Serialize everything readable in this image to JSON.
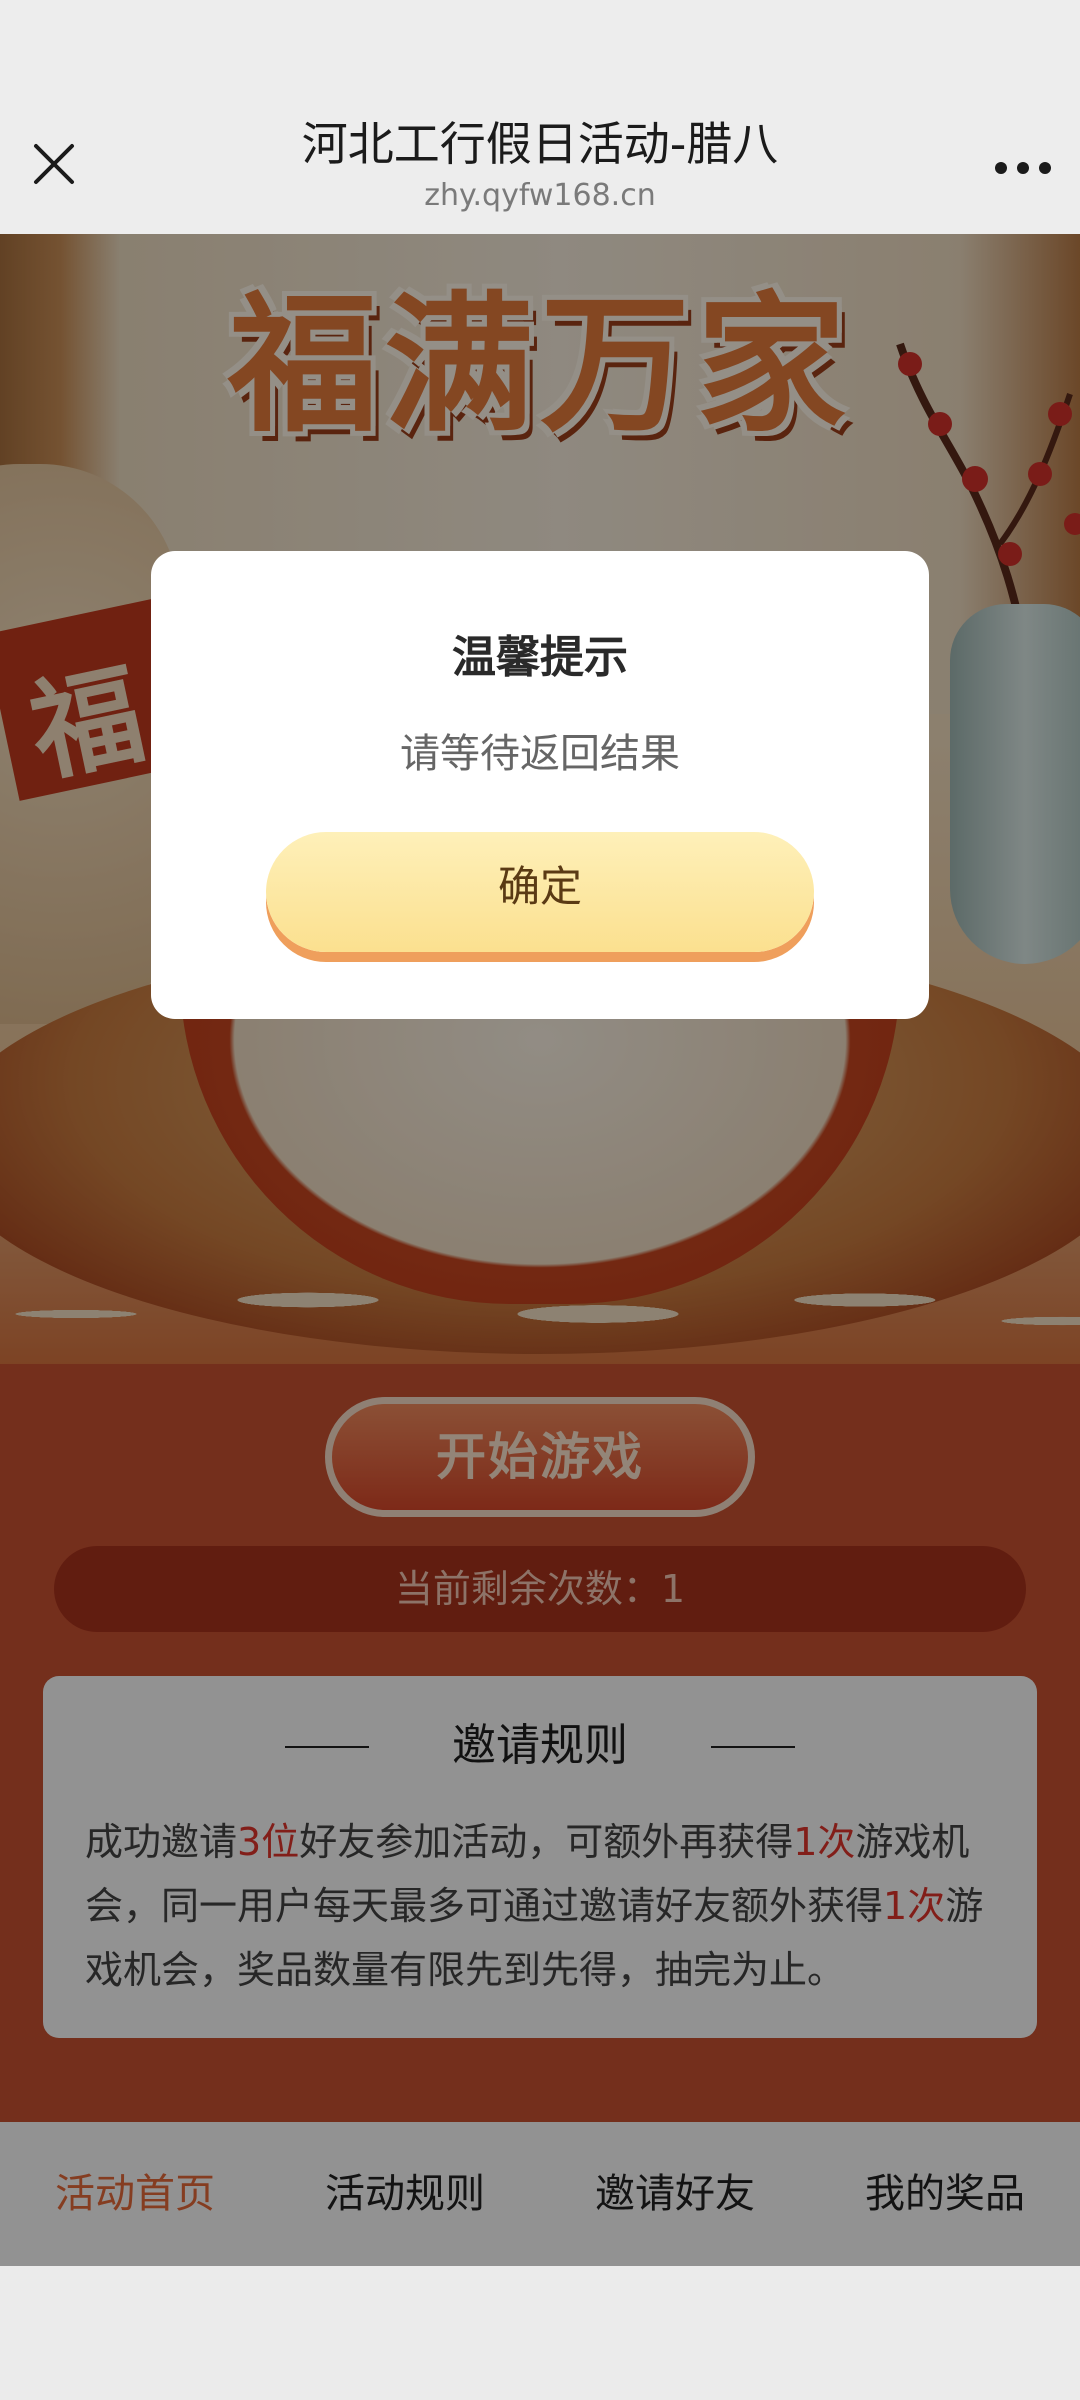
{
  "browser": {
    "title": "河北工行假日活动-腊八",
    "url": "zhy.qyfw168.cn"
  },
  "hero": {
    "title": "福满万家",
    "jar_char": "福"
  },
  "start_button": "开始游戏",
  "remaining": {
    "label": "当前剩余次数：",
    "value": "1"
  },
  "rules": {
    "title": "邀请规则",
    "p1": "成功邀请",
    "n1": "3位",
    "p2": "好友参加活动，可额外再获得",
    "n2": "1次",
    "p3": "游戏机会，同一用户每天最多可通过邀请好友额外获得",
    "n3": "1次",
    "p4": "游戏机会，奖品数量有限先到先得，抽完为止。"
  },
  "tabs": [
    {
      "label": "活动首页",
      "active": true
    },
    {
      "label": "活动规则",
      "active": false
    },
    {
      "label": "邀请好友",
      "active": false
    },
    {
      "label": "我的奖品",
      "active": false
    }
  ],
  "dialog": {
    "title": "温馨提示",
    "message": "请等待返回结果",
    "confirm": "确定"
  },
  "colors": {
    "accent": "#e56a3a",
    "highlight": "#e0352c",
    "dialog_button": "#fbe08f"
  },
  "icons": [
    "close-icon",
    "more-icon"
  ]
}
